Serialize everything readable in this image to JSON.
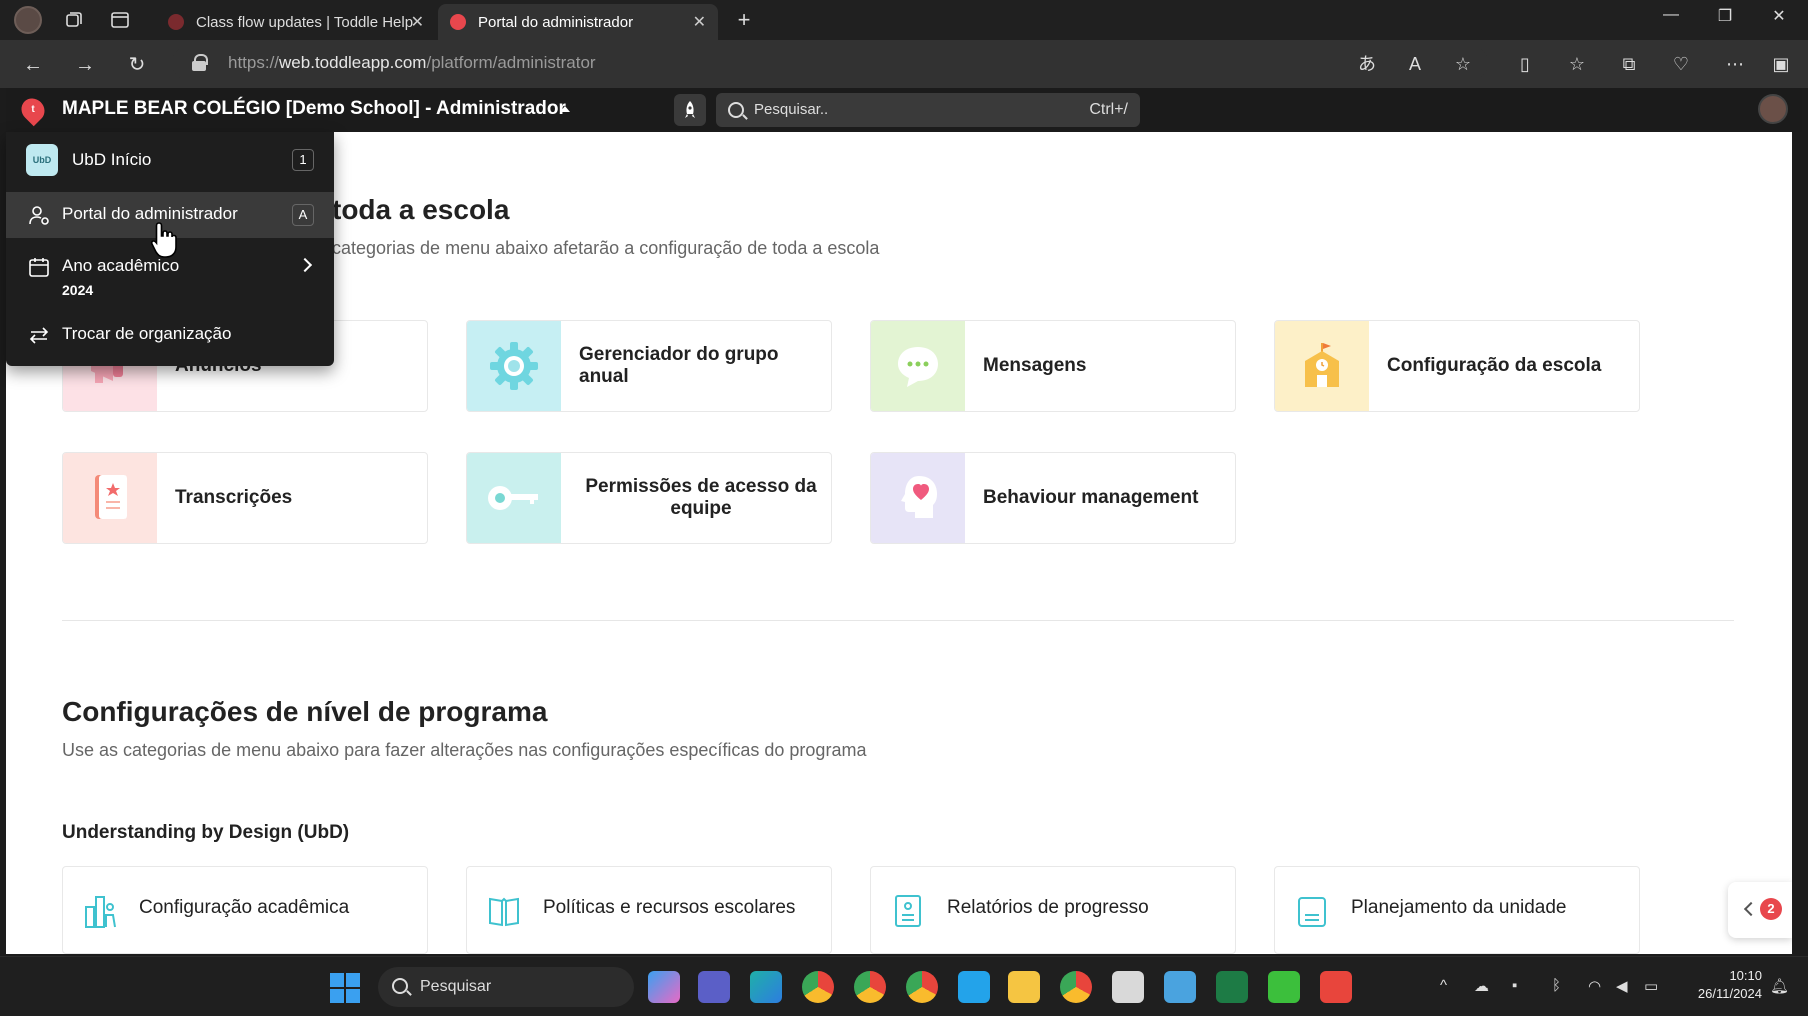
{
  "browser": {
    "tabs": [
      {
        "title": "Class flow updates | Toddle Help C",
        "active": false
      },
      {
        "title": "Portal do administrador",
        "active": true
      }
    ],
    "url_scheme": "https://",
    "url_host": "web.toddleapp.com",
    "url_path": "/platform/administrator"
  },
  "app_header": {
    "school_title": "MAPLE BEAR COLÉGIO [Demo School] - Administrador",
    "search_placeholder": "Pesquisar..",
    "search_shortcut": "Ctrl+/"
  },
  "menu": {
    "items": [
      {
        "label": "UbD Início",
        "badge": "UbD",
        "shortcut": "1"
      },
      {
        "label": "Portal do administrador",
        "shortcut": "A"
      },
      {
        "label": "Ano acadêmico",
        "sublabel": "2024"
      },
      {
        "label": "Trocar de organização"
      }
    ]
  },
  "school_section": {
    "title_visible": "toda a escola",
    "subtitle_visible": "categorias de menu abaixo afetarão a configuração de toda a escola",
    "cards": [
      {
        "label": "Anúncios",
        "icon": "megaphone-icon",
        "tile_color": "#fde1e6"
      },
      {
        "label": "Gerenciador do grupo anual",
        "icon": "gear-icon",
        "tile_color": "#c6eff3"
      },
      {
        "label": "Mensagens",
        "icon": "chat-bubble-icon",
        "tile_color": "#e3f4d3"
      },
      {
        "label": "Configuração da escola",
        "icon": "school-building-icon",
        "tile_color": "#fdf0c8"
      },
      {
        "label": "Transcrições",
        "icon": "transcript-document-icon",
        "tile_color": "#fde4e0"
      },
      {
        "label": "Permissões de acesso da equipe",
        "icon": "key-icon",
        "tile_color": "#c9f0ee"
      },
      {
        "label": "Behaviour management",
        "icon": "head-heart-icon",
        "tile_color": "#e7e4f7"
      }
    ]
  },
  "program_section": {
    "title": "Configurações de nível de programa",
    "subtitle": "Use as categorias de menu abaixo para fazer alterações nas configurações específicas do programa",
    "subheading": "Understanding by Design (UbD)",
    "cards": [
      {
        "label": "Configuração acadêmica",
        "icon": "academic-config-icon"
      },
      {
        "label": "Políticas e recursos escolares",
        "icon": "book-icon"
      },
      {
        "label": "Relatórios de progresso",
        "icon": "report-icon"
      },
      {
        "label": "Planejamento da unidade",
        "icon": "unit-planner-icon"
      }
    ]
  },
  "help_widget": {
    "badge_count": "2"
  },
  "taskbar": {
    "search_label": "Pesquisar",
    "time": "10:10",
    "date": "26/11/2024"
  },
  "colors": {
    "brand_red": "#e8474d",
    "accent_teal": "#3fc2cf"
  }
}
